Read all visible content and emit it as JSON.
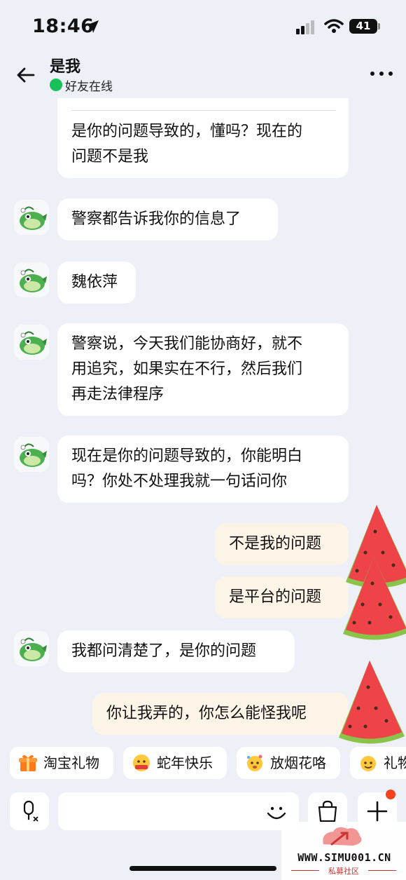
{
  "status_bar": {
    "time": "18:46",
    "battery": "41"
  },
  "header": {
    "title": "是我",
    "status": "好友在线"
  },
  "messages": [
    {
      "side": "left",
      "text": "是你的问题导致的，懂吗？现在的\n问题不是我"
    },
    {
      "side": "left",
      "text": "警察都告诉我你的信息了"
    },
    {
      "side": "left",
      "text": "魏依萍"
    },
    {
      "side": "left",
      "text": "警察说，今天我们能协商好，就不\n用追究，如果实在不行，然后我们\n再走法律程序"
    },
    {
      "side": "left",
      "text": "现在是你的问题导致的，你能明白\n吗？你处不处理我就一句话问你"
    },
    {
      "side": "right",
      "text": "不是我的问题"
    },
    {
      "side": "right",
      "text": "是平台的问题"
    },
    {
      "side": "left",
      "text": "我都问清楚了，是你的问题"
    },
    {
      "side": "right",
      "text": "你让我弄的，你怎么能怪我呢"
    }
  ],
  "quick_chips": [
    {
      "label": "淘宝礼物",
      "icon": "gift-box-icon"
    },
    {
      "label": "蛇年快乐",
      "icon": "snake-new-year-emoji-icon"
    },
    {
      "label": "放烟花咯",
      "icon": "fireworks-emoji-icon"
    },
    {
      "label": "礼物",
      "icon": "gift-emoji-icon"
    }
  ],
  "input_bar": {
    "icons": [
      "voice-input-icon",
      "emoji-icon",
      "shopping-bag-icon",
      "plus-icon"
    ]
  },
  "watermark": {
    "url": "WWW.SIMU001.CN",
    "sub": "私募社区"
  },
  "colors": {
    "background": "#edf0f6",
    "bubble_left": "#ffffff",
    "bubble_right": "#fcf4e6",
    "online": "#19c15a",
    "badge": "#f5421e",
    "watermark": "#cc3333"
  }
}
